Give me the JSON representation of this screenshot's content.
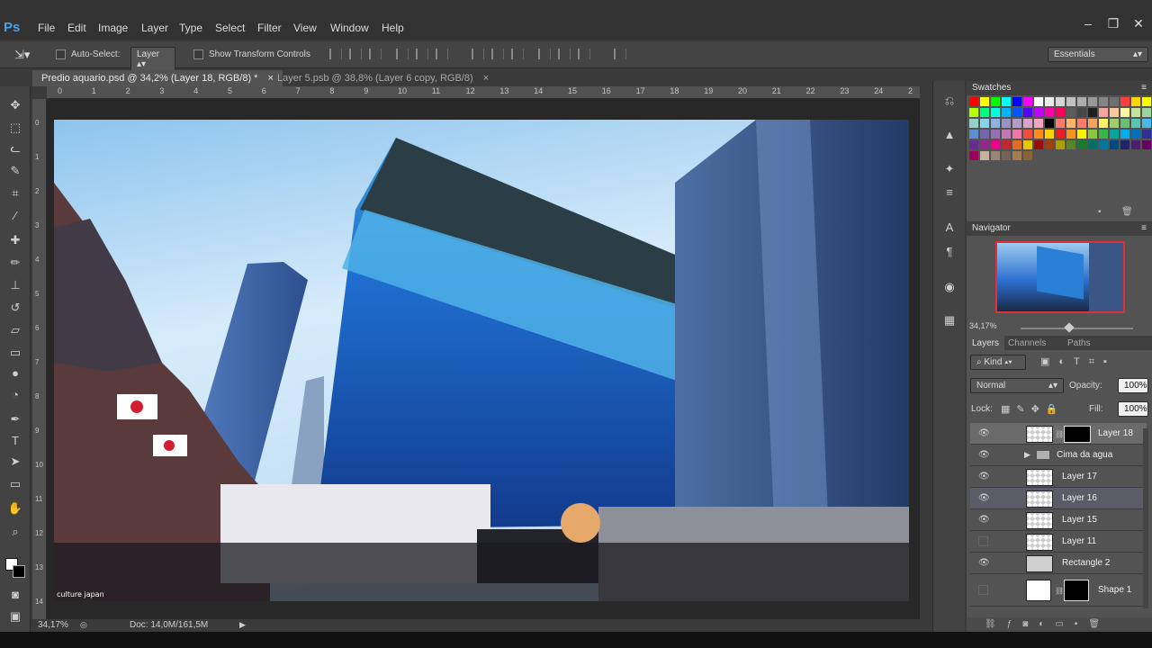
{
  "app": {
    "logo": "Ps",
    "window_controls": [
      "–",
      "❐",
      "✕"
    ]
  },
  "menu": [
    "File",
    "Edit",
    "Image",
    "Layer",
    "Type",
    "Select",
    "Filter",
    "View",
    "Window",
    "Help"
  ],
  "options": {
    "auto_select_label": "Auto-Select:",
    "auto_select_target": "Layer",
    "show_transform_label": "Show Transform Controls",
    "workspace": "Essentials"
  },
  "tabs": [
    {
      "label": "Predio aquario.psd @ 34,2% (Layer 18, RGB/8) *",
      "close": "×"
    },
    {
      "label": "Layer 5.psb @ 38,8% (Layer 6 copy, RGB/8)",
      "close": "×"
    }
  ],
  "ruler_top": [
    "0",
    "1",
    "2",
    "3",
    "4",
    "5",
    "6",
    "7",
    "8",
    "9",
    "10",
    "11",
    "12",
    "13",
    "14",
    "15",
    "16",
    "17",
    "18",
    "19",
    "20",
    "21",
    "22",
    "23",
    "24",
    "2"
  ],
  "ruler_left": [
    "0",
    "1",
    "2",
    "3",
    "4",
    "5",
    "6",
    "7",
    "8",
    "9",
    "1\n0",
    "1\n1",
    "1\n2",
    "1\n3",
    "1\n4"
  ],
  "canvas": {
    "watermark": "culture japan"
  },
  "status": {
    "zoom": "34,17%",
    "doc": "Doc: 14,0M/161,5M"
  },
  "swatches_panel": {
    "title": "Swatches",
    "colors": [
      "#ff0000",
      "#ffff00",
      "#00ff00",
      "#00ffff",
      "#0000ff",
      "#ff00ff",
      "#ffffff",
      "#ebebeb",
      "#d6d6d6",
      "#c2c2c2",
      "#adadad",
      "#999999",
      "#858585",
      "#707070",
      "#ff3b3b",
      "#ffd400",
      "#f7ff00",
      "#b6ff00",
      "#00ff80",
      "#00ffe1",
      "#00b4ff",
      "#0055ff",
      "#5200ff",
      "#c300ff",
      "#ff00a8",
      "#ff0055",
      "#5c5c5c",
      "#474747",
      "#1f1f1f",
      "#f5a49e",
      "#f9c89d",
      "#fff59c",
      "#c6e39a",
      "#9ad49e",
      "#92d4c7",
      "#8bd2ef",
      "#8fb2e3",
      "#9793c7",
      "#b49bc8",
      "#d7a3c9",
      "#f4a4bf",
      "#000000",
      "#ff7b6b",
      "#ffb36b",
      "#ff7b6b",
      "#f5a15f",
      "#fff267",
      "#9ecf6a",
      "#68bf72",
      "#5ac3b1",
      "#4ab9e9",
      "#5b8fd2",
      "#7368b0",
      "#9871b4",
      "#c477b3",
      "#ef77a3",
      "#f24c3d",
      "#ff8c1a",
      "#ffd400",
      "#ed1c24",
      "#f7941d",
      "#fff200",
      "#8dc63f",
      "#39b54a",
      "#00a99d",
      "#00aeef",
      "#0072bc",
      "#2e3192",
      "#662d91",
      "#92278f",
      "#ec008c",
      "#c1272d",
      "#e66b1f",
      "#e5c600",
      "#9e0b0f",
      "#a0410d",
      "#aba000",
      "#598527",
      "#197b30",
      "#007366",
      "#0076a3",
      "#004a80",
      "#21246b",
      "#4b1d6b",
      "#630460",
      "#9e005d",
      "#c7b299",
      "#998675",
      "#736357",
      "#a67c52",
      "#8c6239"
    ]
  },
  "navigator_panel": {
    "title": "Navigator",
    "zoom": "34,17%"
  },
  "layers_panel": {
    "tabs": [
      "Layers",
      "Channels",
      "Paths"
    ],
    "kind_label": "Kind",
    "blend_mode": "Normal",
    "opacity_label": "Opacity:",
    "opacity_value": "100%",
    "lock_label": "Lock:",
    "fill_label": "Fill:",
    "fill_value": "100%",
    "layers": [
      {
        "name": "Layer 18",
        "visible": true,
        "selected": true,
        "mask": true
      },
      {
        "name": "Cima da agua",
        "visible": true,
        "group": true
      },
      {
        "name": "Layer 17",
        "visible": true
      },
      {
        "name": "Layer 16",
        "visible": true
      },
      {
        "name": "Layer 15",
        "visible": true
      },
      {
        "name": "Layer 11",
        "visible": false
      },
      {
        "name": "Rectangle 2",
        "visible": true
      },
      {
        "name": "Shape 1",
        "visible": false,
        "mask": true
      }
    ]
  },
  "colors": {
    "accent": "#4aa0e8",
    "selected_layer": "#6b6b6b",
    "panel_bg": "#535353"
  }
}
